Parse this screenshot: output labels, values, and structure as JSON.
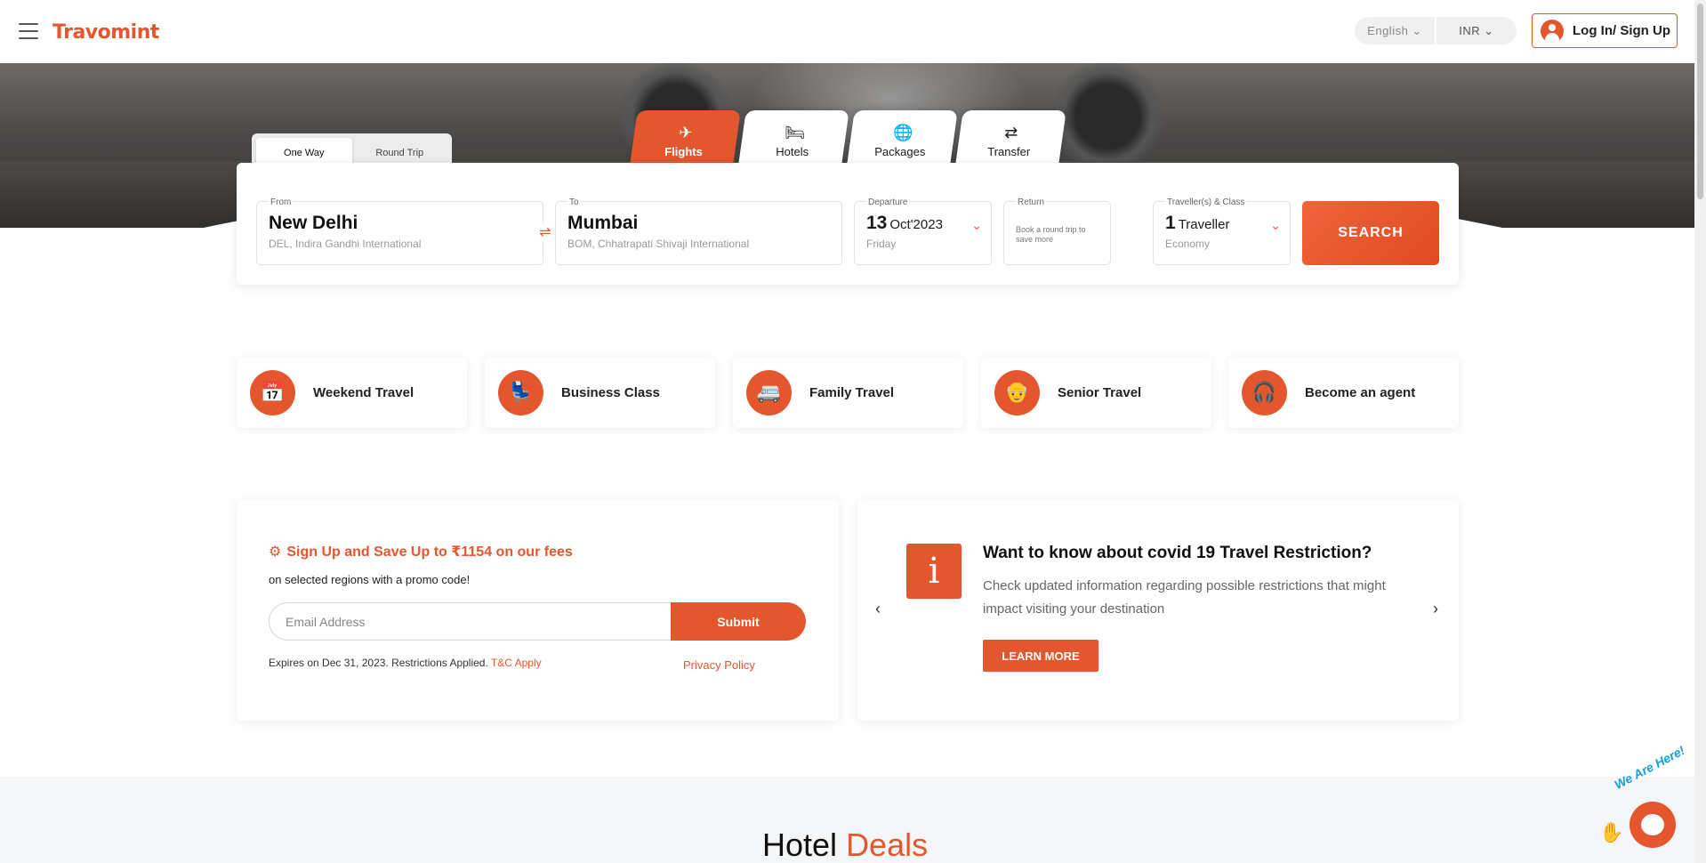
{
  "header": {
    "logo": "Travomint",
    "language": "English",
    "currency": "INR",
    "login_label": "Log In/ Sign Up"
  },
  "trip_types": [
    "One Way",
    "Round Trip"
  ],
  "tabs": [
    {
      "label": "Flights",
      "icon": "plane-icon"
    },
    {
      "label": "Hotels",
      "icon": "bed-icon"
    },
    {
      "label": "Packages",
      "icon": "globe-icon"
    },
    {
      "label": "Transfer",
      "icon": "transfer-icon"
    }
  ],
  "search": {
    "from_caption": "From",
    "from_city": "New Delhi",
    "from_airport": "DEL, Indira Gandhi International",
    "to_caption": "To",
    "to_city": "Mumbai",
    "to_airport": "BOM, Chhatrapati Shivaji International",
    "departure_caption": "Departure",
    "departure_day": "13",
    "departure_month": "Oct'2023",
    "departure_weekday": "Friday",
    "return_caption": "Return",
    "return_hint": "Book a round trip to save more",
    "traveller_caption": "Traveller(s) & Class",
    "traveller_count": "1",
    "traveller_label": "Traveller",
    "traveller_class": "Economy",
    "search_label": "SEARCH"
  },
  "categories": [
    {
      "label": "Weekend Travel",
      "icon": "calendar-icon"
    },
    {
      "label": "Business Class",
      "icon": "seat-icon"
    },
    {
      "label": "Family Travel",
      "icon": "car-icon"
    },
    {
      "label": "Senior Travel",
      "icon": "senior-icon"
    },
    {
      "label": "Become an agent",
      "icon": "agent-icon"
    }
  ],
  "promo": {
    "title": "Sign Up and Save Up to ₹1154 on our fees",
    "subtitle": "on selected regions with a promo code!",
    "email_placeholder": "Email Address",
    "submit_label": "Submit",
    "expires": "Expires on Dec 31, 2023. Restrictions Applied.",
    "tc_label": "T&C Apply",
    "privacy_label": "Privacy Policy"
  },
  "covid": {
    "heading": "Want to know about covid 19 Travel Restriction?",
    "text": "Check updated information regarding possible restrictions that might impact visiting your destination",
    "cta": "LEARN MORE"
  },
  "deals": {
    "title_part1": "Hotel",
    "title_part2": "Deals"
  },
  "chat": {
    "label": "We Are Here!"
  },
  "colors": {
    "accent": "#e4572e",
    "chat_text": "#1a9fd8"
  }
}
